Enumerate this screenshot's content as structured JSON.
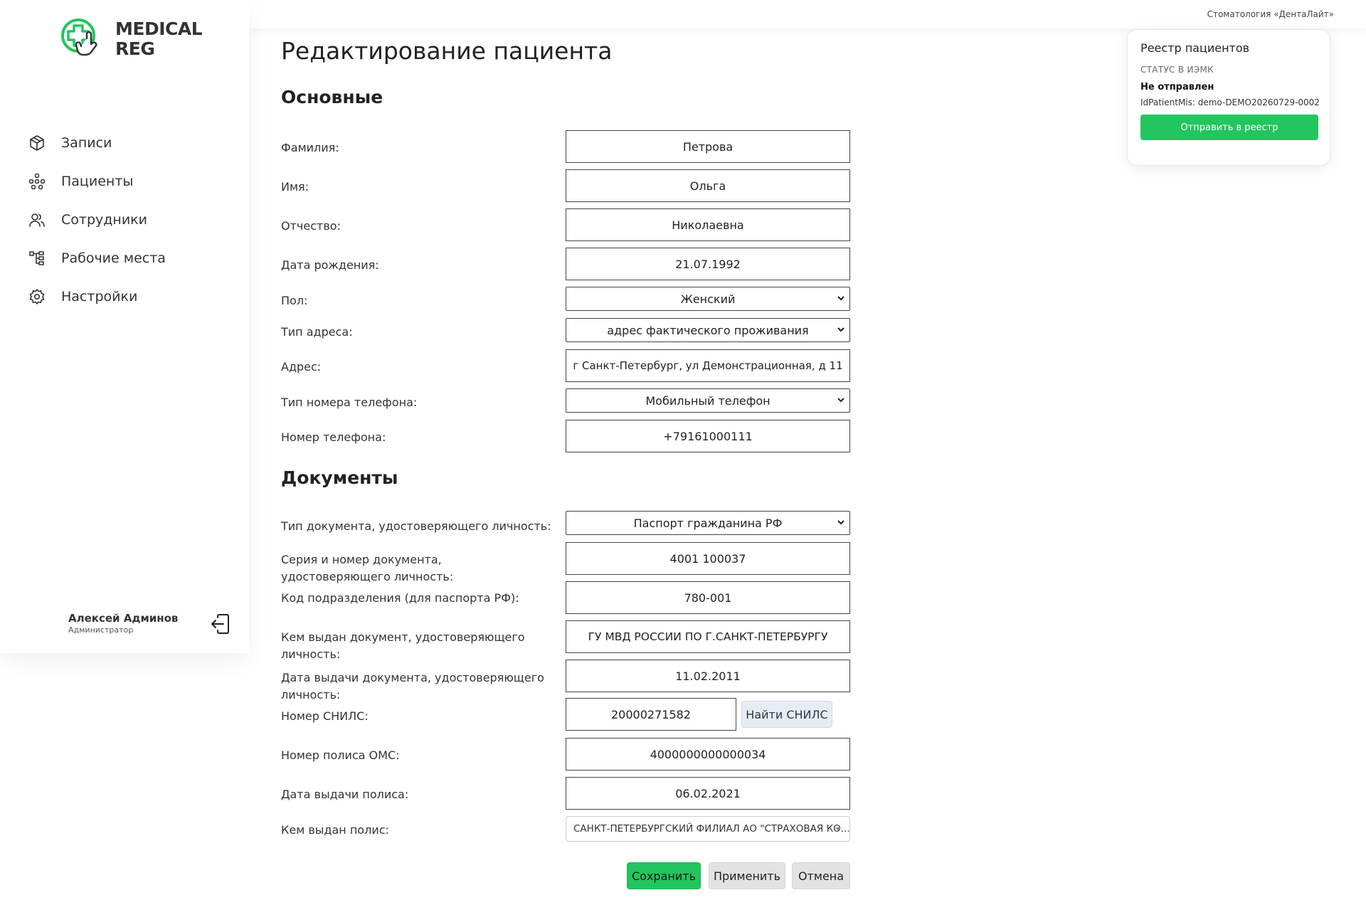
{
  "header": {
    "clinic_name": "Стоматология «ДентаЛайт»"
  },
  "sidebar": {
    "logo_text_line1": "MEDICAL",
    "logo_text_line2": "REG",
    "items": [
      {
        "label": "Записи",
        "icon": "box-icon"
      },
      {
        "label": "Пациенты",
        "icon": "users-network-icon"
      },
      {
        "label": "Сотрудники",
        "icon": "staff-icon"
      },
      {
        "label": "Рабочие места",
        "icon": "workplaces-icon"
      },
      {
        "label": "Настройки",
        "icon": "gear-icon"
      }
    ],
    "user": {
      "name": "Алексей Админов",
      "role": "Администратор"
    }
  },
  "page": {
    "title": "Редактирование пациента",
    "sections": {
      "basic": "Основные",
      "documents": "Документы"
    }
  },
  "basic": {
    "last_name": {
      "label": "Фамилия:",
      "value": "Петрова"
    },
    "first_name": {
      "label": "Имя:",
      "value": "Ольга"
    },
    "patronymic": {
      "label": "Отчество:",
      "value": "Николаевна"
    },
    "birth_date": {
      "label": "Дата рождения:",
      "value": "21.07.1992"
    },
    "gender": {
      "label": "Пол:",
      "value": "Женский"
    },
    "address_type": {
      "label": "Тип адреса:",
      "value": "адрес фактического проживания"
    },
    "address": {
      "label": "Адрес:",
      "value": "г Санкт-Петербург, ул Демонстрационная, д 11"
    },
    "phone_type": {
      "label": "Тип номера телефона:",
      "value": "Мобильный телефон"
    },
    "phone": {
      "label": "Номер телефона:",
      "value": "+79161000111"
    }
  },
  "documents": {
    "doc_type": {
      "label": "Тип документа, удостоверяющего личность:",
      "value": "Паспорт гражданина РФ"
    },
    "doc_number": {
      "label": "Серия и номер документа, удостоверяющего личность:",
      "value": "4001 100037"
    },
    "division_code": {
      "label": "Код подразделения (для паспорта РФ):",
      "value": "780-001"
    },
    "issued_by": {
      "label": "Кем выдан документ, удостоверяющего личность:",
      "value": "ГУ МВД РОССИИ ПО Г.САНКТ-ПЕТЕРБУРГУ"
    },
    "issue_date": {
      "label": "Дата выдачи документа, удостоверяющего личность:",
      "value": "11.02.2011"
    },
    "snils": {
      "label": "Номер СНИЛС:",
      "value": "20000271582",
      "button": "Найти СНИЛС"
    },
    "oms_number": {
      "label": "Номер полиса ОМС:",
      "value": "4000000000000034"
    },
    "policy_date": {
      "label": "Дата выдачи полиса:",
      "value": "06.02.2021"
    },
    "policy_issuer": {
      "label": "Кем выдан полис:",
      "value": "САНКТ-ПЕТЕРБУРГСКИЙ ФИЛИАЛ АО \"СТРАХОВАЯ КО..."
    }
  },
  "actions": {
    "save": "Сохранить",
    "apply": "Применить",
    "cancel": "Отмена"
  },
  "registry": {
    "title": "Реестр пациентов",
    "status_label": "СТАТУС В ИЭМК",
    "status": "Не отправлен",
    "id_line": "IdPatientMis: demo-DEMO20260729-0002",
    "send_button": "Отправить в реестр"
  },
  "colors": {
    "accent": "#22c55e",
    "text": "#222222"
  }
}
